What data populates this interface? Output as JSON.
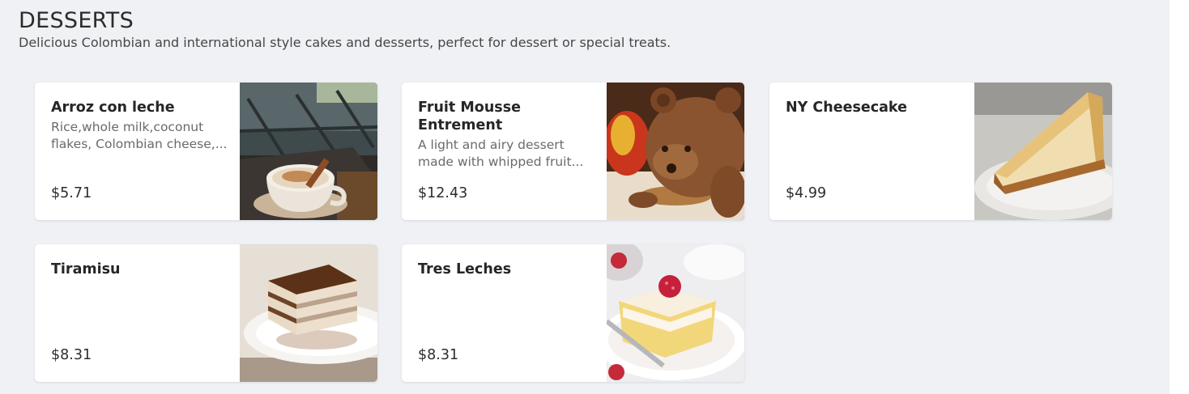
{
  "section": {
    "title": "DESSERTS",
    "description": "Delicious Colombian and international style cakes and desserts, perfect for dessert or special treats."
  },
  "items": [
    {
      "name": "Arroz con leche",
      "description": "Rice,whole milk,coconut flakes, Colombian cheese,...",
      "price": "$5.71",
      "image_icon": "rice-pudding-cup-photo"
    },
    {
      "name": "Fruit Mousse Entrement",
      "description": "A light and airy dessert made with whipped fruit...",
      "price": "$12.43",
      "image_icon": "bear-mousse-cake-photo"
    },
    {
      "name": "NY Cheesecake",
      "description": "",
      "price": "$4.99",
      "image_icon": "cheesecake-slice-photo"
    },
    {
      "name": "Tiramisu",
      "description": "",
      "price": "$8.31",
      "image_icon": "tiramisu-slice-photo"
    },
    {
      "name": "Tres Leches",
      "description": "",
      "price": "$8.31",
      "image_icon": "tres-leches-cake-photo"
    }
  ],
  "colors": {
    "background": "#f0f1f5",
    "card": "#ffffff",
    "text": "#2d2d2d",
    "muted": "#6a6a6a"
  }
}
